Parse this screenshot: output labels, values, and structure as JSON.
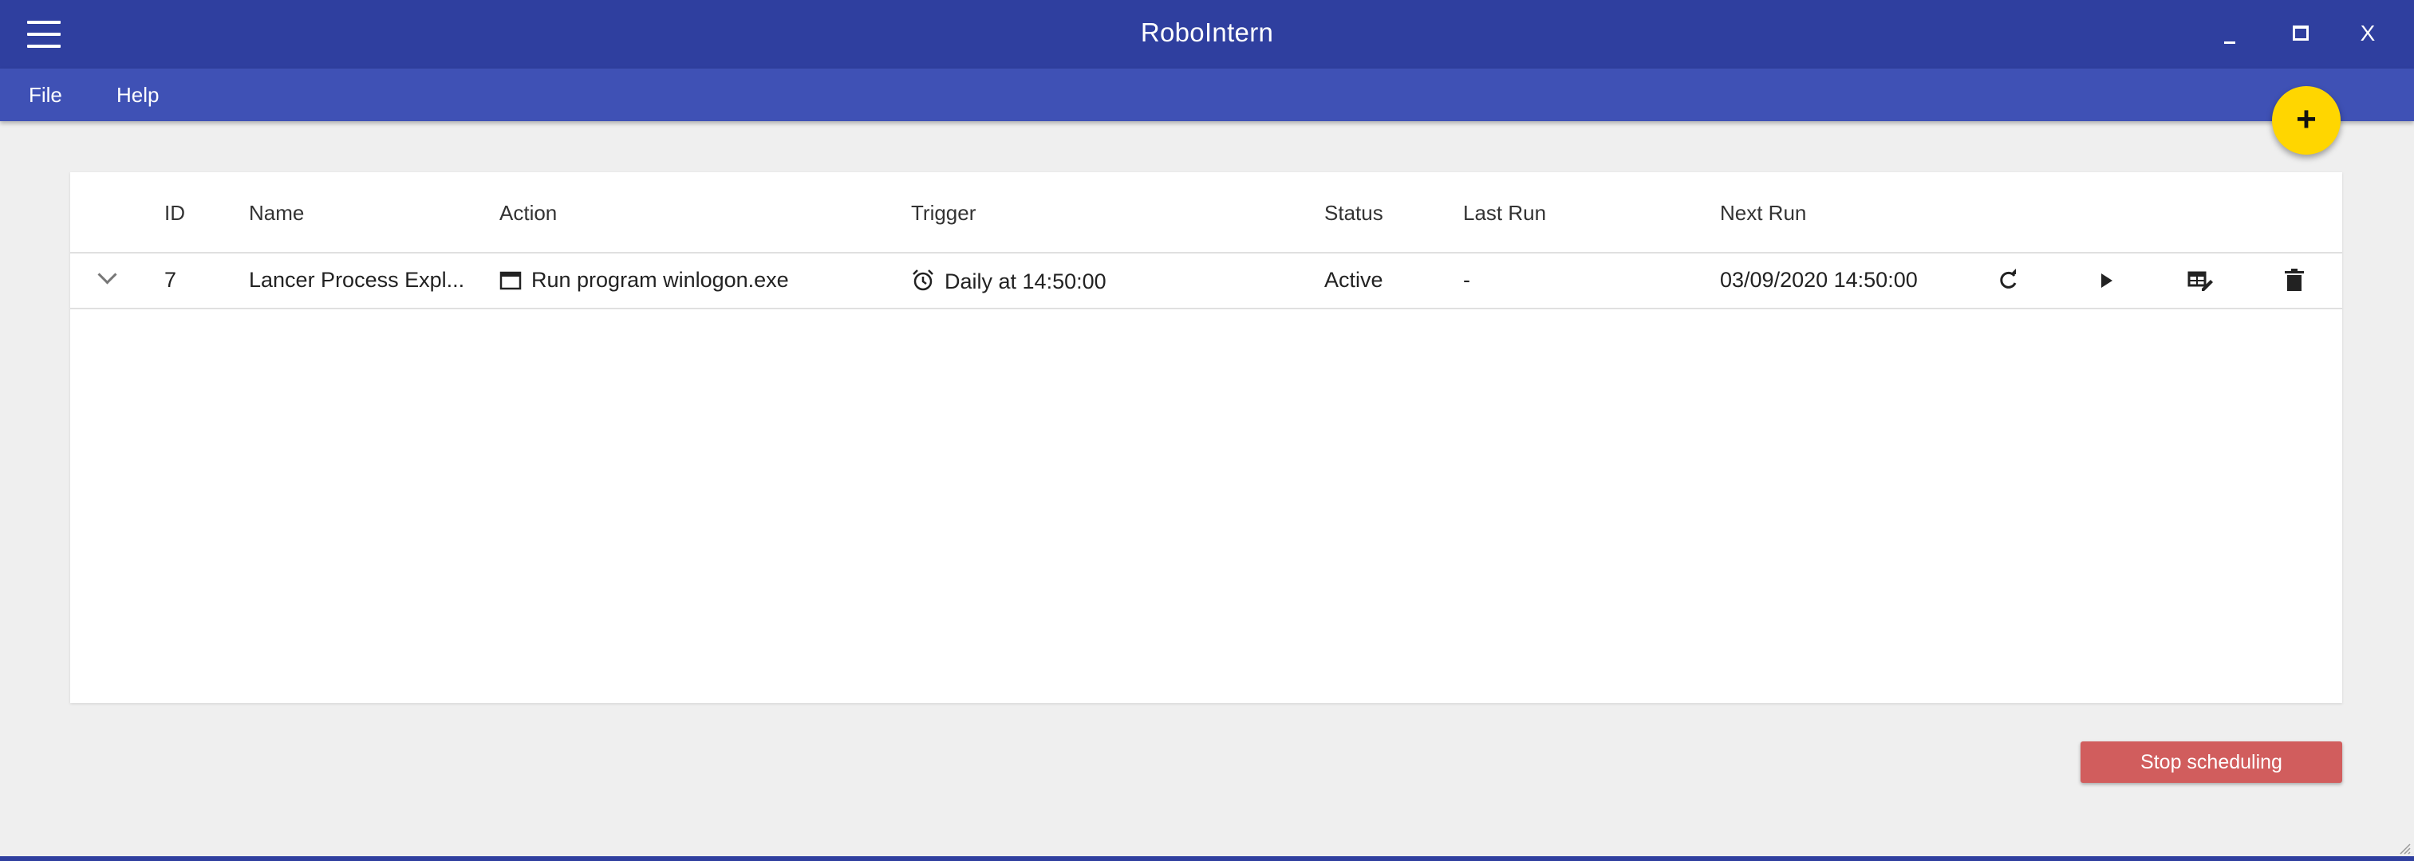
{
  "window": {
    "title": "RoboIntern",
    "controls": {
      "minimize": "_",
      "maximize": "□",
      "close": "X"
    },
    "accent_color": "#3f51b5",
    "titlebar_color": "#2f3f9f"
  },
  "menu": {
    "file": "File",
    "help": "Help"
  },
  "fab": {
    "label": "+",
    "color": "#ffd600"
  },
  "table": {
    "columns": [
      "ID",
      "Name",
      "Action",
      "Trigger",
      "Status",
      "Last Run",
      "Next Run"
    ],
    "rows": [
      {
        "id": "7",
        "name": "Lancer Process Expl...",
        "action": "Run program winlogon.exe",
        "action_icon": "window-icon",
        "trigger": "Daily at 14:50:00",
        "trigger_icon": "alarm-clock-icon",
        "status": "Active",
        "last_run": "-",
        "next_run": "03/09/2020 14:50:00",
        "row_actions": [
          "refresh-icon",
          "play-icon",
          "edit-table-icon",
          "delete-icon"
        ]
      }
    ]
  },
  "footer": {
    "stop_button": "Stop scheduling",
    "stop_color": "#d15d5d"
  }
}
